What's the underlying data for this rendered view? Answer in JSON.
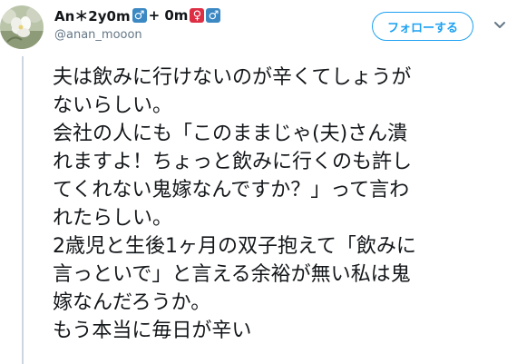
{
  "user": {
    "display_name_prefix": "An＊2y0m",
    "display_name_middle": "+ 0m",
    "badge_male": "♂",
    "badge_female": "♀",
    "handle": "@anan_mooon"
  },
  "actions": {
    "follow_label": "フォローする",
    "menu_icon": "chevron-down-icon"
  },
  "tweet": {
    "lines": [
      "夫は飲みに行けないのが辛くてしょうが",
      "ないらしい。",
      "会社の人にも「このままじゃ(夫)さん潰",
      "れますよ！ちょっと飲みに行くのも許し",
      "てくれない鬼嫁なんですか？」って言わ",
      "れたらしい。",
      "2歳児と生後1ヶ月の双子抱えて「飲みに",
      "言っといで」と言える余裕が無い私は鬼",
      "嫁なんだろうか。",
      "もう本当に毎日が辛い"
    ]
  },
  "colors": {
    "accent": "#1da1f2",
    "text": "#14171a",
    "muted": "#657786",
    "thread": "#ccd6dd",
    "male": "#3b88c3",
    "female": "#dd2e44"
  }
}
